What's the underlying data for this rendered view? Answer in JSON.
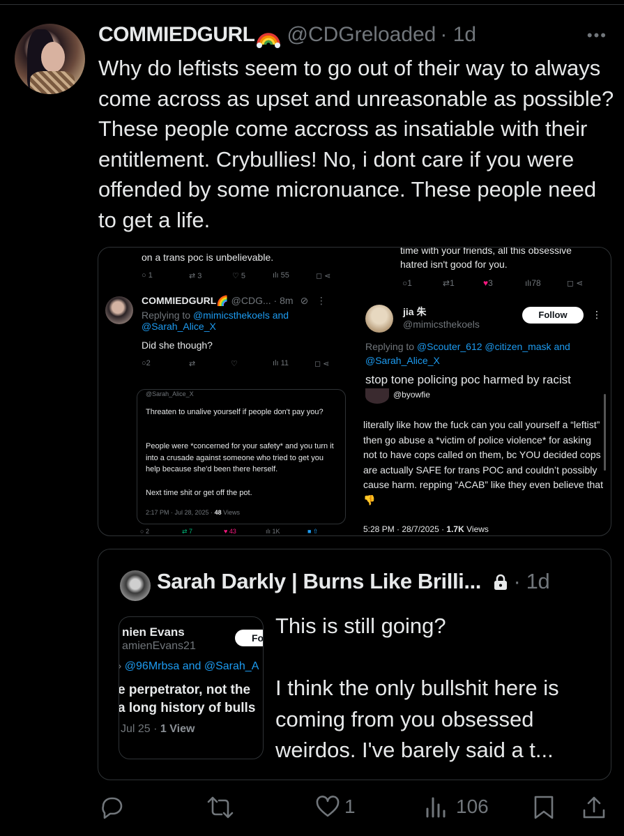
{
  "tweet": {
    "author": "COMMIEDGURL",
    "handle": "@CDGreloaded",
    "time": "· 1d",
    "more": "•••",
    "text": "Why do leftists seem to go out of their way to always come across as upset and unreasonable as possible? These people come accross as insatiable with their entitlement. Crybullies! No, i dont care if you were offended by some micronuance. These people need to get a life."
  },
  "media": {
    "left_top": {
      "text": "on a trans poc is unbelievable.",
      "stats": {
        "replies": "1",
        "reposts": "3",
        "likes": "5",
        "views": "55"
      }
    },
    "left_reply": {
      "author": "COMMIEDGURL",
      "handle": "@CDG...",
      "time": "· 8m",
      "replying_prefix": "Replying to",
      "replying_to": "@mimicsthekoels and",
      "replying_to2": "@Sarah_Alice_X",
      "text": "Did she though?",
      "stats": {
        "replies": "2",
        "views": "11"
      }
    },
    "dark_card": {
      "handle": "@Sarah_Alice_X",
      "p1": "Threaten to unalive yourself if people don't pay you?",
      "p2": "People were *concerned for your safety* and you turn it into a crusade against someone who tried to get you help because she'd been there herself.",
      "p3": "Next time shit or get off the pot.",
      "meta_time": "2:17 PM · Jul 28, 2025 ·",
      "meta_views_num": "48",
      "meta_views_label": "Views",
      "stats": {
        "replies": "2",
        "reposts": "7",
        "likes": "43",
        "views": "1K"
      }
    },
    "right_top": {
      "text1": "time with your friends, all this obsessive",
      "text2": "hatred isn't good for you.",
      "stats": {
        "replies": "1",
        "reposts": "1",
        "likes": "3",
        "views": "78"
      }
    },
    "right_reply": {
      "author": "jia 朱",
      "handle": "@mimicsthekoels",
      "follow": "Follow",
      "replying_prefix": "Replying to",
      "replying_to": "@Scouter_612 @citizen_mask and",
      "replying_to2": "@Sarah_Alice_X",
      "text": "stop tone policing poc harmed by racist"
    },
    "right_bottom": {
      "handle": "@byowfie",
      "text": "literally like how the fuck can you call yourself a “leftist” then go abuse a *victim of police violence* for asking not to have cops called on them, bc YOU decided cops are actually SAFE for trans POC and couldn’t possibly cause harm. repping “ACAB” like they even believe that👎",
      "meta_time": "5:28 PM · 28/7/2025 ·",
      "meta_views_num": "1.7K",
      "meta_views_label": "Views"
    }
  },
  "quote": {
    "author": "Sarah Darkly | Burns Like Brilli...",
    "time": "· 1d",
    "text": "This is still going?\n\nI think the only bullshit here is coming from you obsessed weirdos. I've barely said a t...",
    "thumb": {
      "name": "nien Evans",
      "handle": "amienEvans21",
      "follow": "Fo",
      "replying": "@96Mrbsa and @Sarah_A",
      "line1": "e perpetrator, not the",
      "line2": "a long history of bulls",
      "meta": "Jul 25 ·",
      "meta_views": "1 View"
    }
  },
  "actions": {
    "replies": "",
    "reposts": "",
    "likes": "1",
    "views": "106"
  },
  "colors": {
    "background": "#000000",
    "text": "#e7e9ea",
    "muted": "#71767b",
    "link": "#1d9bf0",
    "like": "#f91880",
    "repost": "#00ba7c"
  }
}
